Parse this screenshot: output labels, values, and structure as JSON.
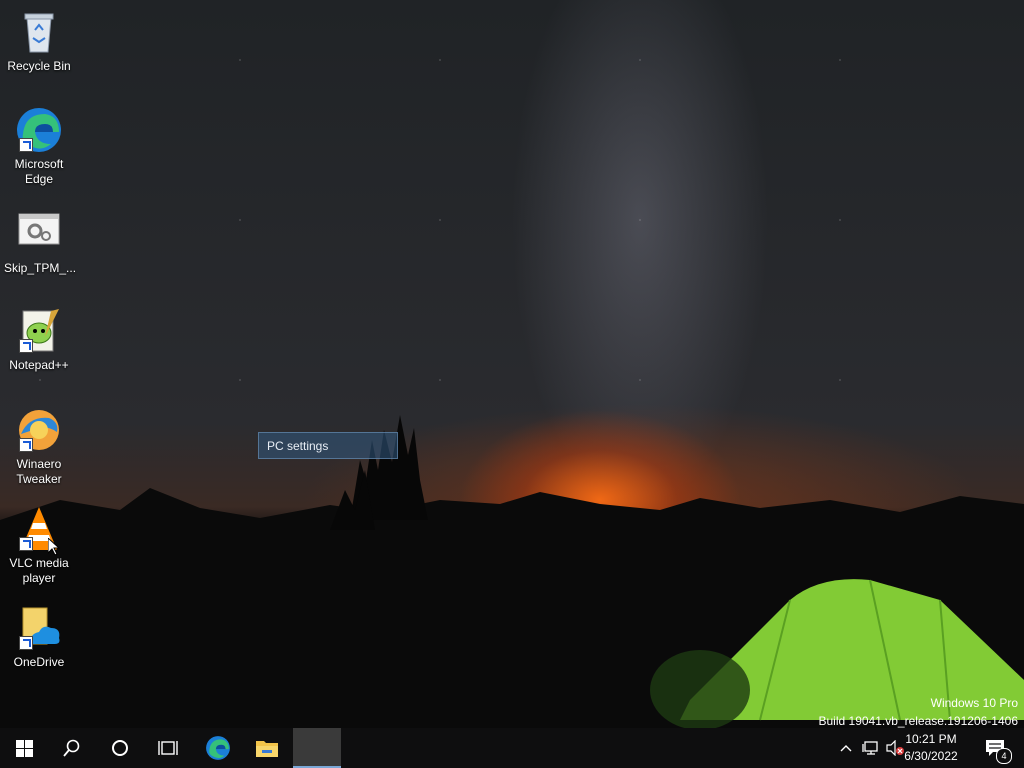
{
  "desktop": {
    "icons": [
      {
        "label": "Recycle Bin",
        "icon": "recycle-bin-icon"
      },
      {
        "label": "Microsoft Edge",
        "icon": "edge-icon"
      },
      {
        "label": "Skip_TPM_...",
        "icon": "settings-script-icon"
      },
      {
        "label": "Notepad++",
        "icon": "notepad-plus-plus-icon"
      },
      {
        "label": "Winaero Tweaker",
        "icon": "winaero-tweaker-icon"
      },
      {
        "label": "VLC media player",
        "icon": "vlc-icon"
      },
      {
        "label": "OneDrive",
        "icon": "onedrive-icon"
      }
    ],
    "drag_tooltip": "PC settings",
    "watermark": {
      "line1": "Windows 10 Pro",
      "line2": "Build 19041.vb_release.191206-1406"
    }
  },
  "taskbar": {
    "buttons": [
      "start-button",
      "search-button",
      "cortana-button",
      "task-view-button",
      "edge-taskbar-button",
      "file-explorer-taskbar-button",
      "active-window-button"
    ],
    "clock": {
      "time": "10:21 PM",
      "date": "6/30/2022"
    },
    "notifications_count": "4"
  },
  "colors": {
    "taskbar_bg": "#0e0e0f",
    "accent": "#7aa7d6",
    "tent_green": "#8fe03a"
  }
}
